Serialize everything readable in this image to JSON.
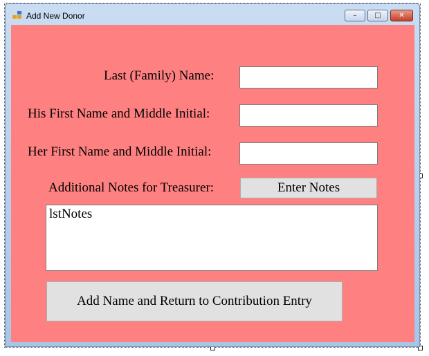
{
  "window": {
    "title": "Add New Donor",
    "controls": {
      "minimize": "–",
      "maximize": "□",
      "close": "✕"
    }
  },
  "form": {
    "last_name_label": "Last (Family) Name:",
    "last_name_value": "",
    "his_first_label": "His First Name and Middle Initial:",
    "his_first_value": "",
    "her_first_label": "Her First Name and Middle Initial:",
    "her_first_value": "",
    "notes_label": "Additional Notes for Treasurer:",
    "enter_notes_button": "Enter Notes",
    "notes_list_text": "lstNotes",
    "submit_button": "Add Name and Return to Contribution Entry"
  },
  "colors": {
    "form_background": "#ff8080",
    "button_face": "#e1e1e1"
  }
}
